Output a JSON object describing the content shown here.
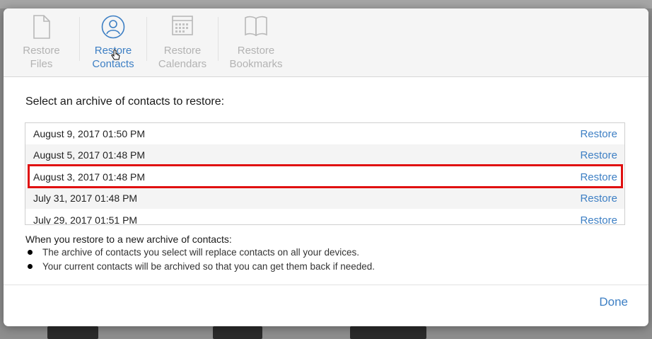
{
  "toolbar": {
    "items": [
      {
        "label_line1": "Restore",
        "label_line2": "Files",
        "icon": "document-icon",
        "active": false
      },
      {
        "label_line1": "Restore",
        "label_line2": "Contacts",
        "icon": "person-icon",
        "active": true
      },
      {
        "label_line1": "Restore",
        "label_line2": "Calendars",
        "icon": "calendar-icon",
        "active": false
      },
      {
        "label_line1": "Restore",
        "label_line2": "Bookmarks",
        "icon": "book-icon",
        "active": false
      }
    ]
  },
  "main": {
    "heading": "Select an archive of contacts to restore:",
    "archives": [
      {
        "date": "August 9, 2017 01:50 PM",
        "action": "Restore"
      },
      {
        "date": "August 5, 2017 01:48 PM",
        "action": "Restore"
      },
      {
        "date": "August 3, 2017 01:48 PM",
        "action": "Restore",
        "highlighted": true
      },
      {
        "date": "July 31, 2017 01:48 PM",
        "action": "Restore"
      },
      {
        "date": "July 29, 2017 01:51 PM",
        "action": "Restore"
      }
    ],
    "info_heading": "When you restore to a new archive of contacts:",
    "bullets": [
      "The archive of contacts you select will replace contacts on all your devices.",
      "Your current contacts will be archived so that you can get them back if needed."
    ]
  },
  "footer": {
    "done_label": "Done"
  },
  "colors": {
    "accent": "#3d7fc4",
    "disabled": "#b3b3b3",
    "highlight": "#e01010"
  }
}
